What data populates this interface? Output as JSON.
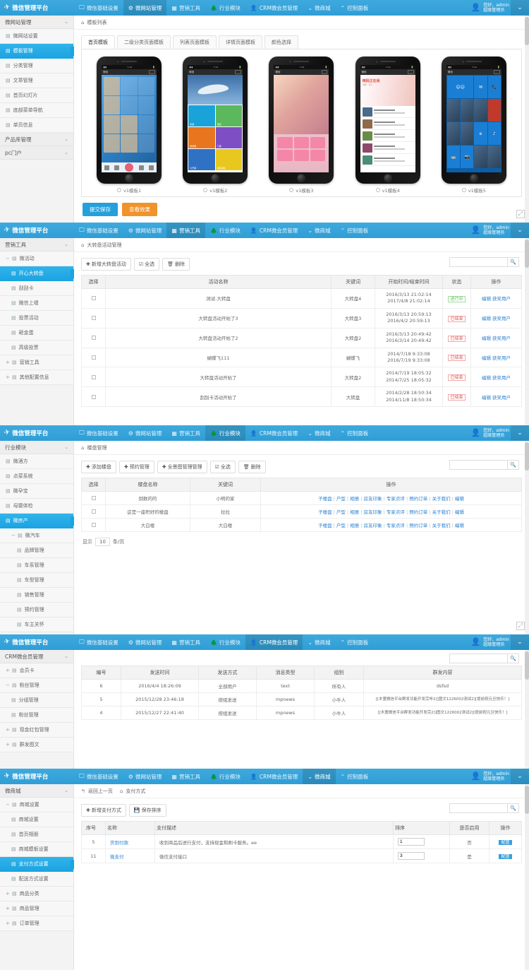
{
  "brand": {
    "name": "微信管理平台",
    "logo_icon": "paper-plane-icon"
  },
  "topnav": [
    {
      "label": "微信基础设置",
      "icon": "monitor-icon",
      "active": false
    },
    {
      "label": "微网站管理",
      "icon": "gear-icon",
      "active": true
    },
    {
      "label": "营销工具",
      "icon": "grid-icon",
      "active": false
    },
    {
      "label": "行业模块",
      "icon": "tree-icon",
      "active": false
    },
    {
      "label": "CRM微会员管理",
      "icon": "user-icon",
      "active": false
    },
    {
      "label": "微商城",
      "icon": "chevron-down-icon",
      "active": false
    },
    {
      "label": "控制面板",
      "icon": "chevron-up-icon",
      "active": false
    }
  ],
  "user": {
    "greeting": "您好，admin",
    "role": "超级管理员",
    "avatar_icon": "user-avatar-icon",
    "caret_icon": "chevron-down-icon"
  },
  "search": {
    "placeholder": "",
    "value": "",
    "icon": "search-icon"
  },
  "panel1": {
    "nav_active": "微网站管理",
    "breadcrumb": "模板列表",
    "sidebar_title": "微网站管理",
    "sidebar": [
      {
        "label": "微网站设置",
        "level": 1,
        "active": false,
        "pm": ""
      },
      {
        "label": "模板管理",
        "level": 1,
        "active": true,
        "pm": ""
      },
      {
        "label": "分类管理",
        "level": 1,
        "active": false,
        "pm": ""
      },
      {
        "label": "文章管理",
        "level": 1,
        "active": false,
        "pm": ""
      },
      {
        "label": "首页幻灯片",
        "level": 1,
        "active": false,
        "pm": ""
      },
      {
        "label": "底部菜单导航",
        "level": 1,
        "active": false,
        "pm": ""
      },
      {
        "label": "单页信息",
        "level": 1,
        "active": false,
        "pm": ""
      }
    ],
    "sidebar_groups": [
      {
        "label": "产品库管理",
        "chev": "⌄"
      },
      {
        "label": "pc门户",
        "chev": "⌄"
      }
    ],
    "tabs": [
      {
        "label": "首页模板",
        "active": true
      },
      {
        "label": "二级分类页面模板",
        "active": false
      },
      {
        "label": "列表页面模板",
        "active": false
      },
      {
        "label": "详情页面模板",
        "active": false
      },
      {
        "label": "颜色选择",
        "active": false
      }
    ],
    "templates": [
      {
        "label": "v1模板1",
        "selected": false
      },
      {
        "label": "v1模板2",
        "selected": false
      },
      {
        "label": "v1模板3",
        "selected": false
      },
      {
        "label": "v1模板4",
        "selected": false
      },
      {
        "label": "v1模板5",
        "selected": false
      }
    ],
    "phone2_tiles": [
      "机票",
      "酒店",
      "旅游团",
      "门票",
      "大巴票",
      "游轮邮轮"
    ],
    "buttons": [
      {
        "label": "提交保存",
        "color": "#26a0da"
      },
      {
        "label": "查看效果",
        "color": "#f0932b"
      }
    ]
  },
  "panel2": {
    "nav_active": "营销工具",
    "breadcrumb": "大转盘活动管理",
    "sidebar_title": "营销工具",
    "sidebar": [
      {
        "label": "微活动",
        "level": 1,
        "active": false,
        "pm": "−"
      },
      {
        "label": "开心大转盘",
        "level": 2,
        "active": true,
        "pm": ""
      },
      {
        "label": "刮刮卡",
        "level": 2,
        "active": false,
        "pm": ""
      },
      {
        "label": "微信上墙",
        "level": 2,
        "active": false,
        "pm": ""
      },
      {
        "label": "投票活动",
        "level": 2,
        "active": false,
        "pm": ""
      },
      {
        "label": "砸金蛋",
        "level": 2,
        "active": false,
        "pm": ""
      },
      {
        "label": "高级投票",
        "level": 2,
        "active": false,
        "pm": ""
      },
      {
        "label": "营销工具",
        "level": 1,
        "active": false,
        "pm": "+"
      },
      {
        "label": "其他配置信息",
        "level": 1,
        "active": false,
        "pm": "+"
      }
    ],
    "toolbar": [
      {
        "label": "新增大转盘活动",
        "icon": "plus-icon"
      },
      {
        "label": "全选",
        "icon": "checkbox-icon"
      },
      {
        "label": "删除",
        "icon": "trash-icon"
      }
    ],
    "columns": [
      "选择",
      "活动名称",
      "关键词",
      "开始时间/结束时间",
      "状态",
      "操作"
    ],
    "rows": [
      {
        "name": "测试-大转盘",
        "keyword": "大转盘4",
        "start": "2016/3/13 21:02:14",
        "end": "2017/4/8 21:02:14",
        "status": "进行中",
        "status_type": "running",
        "ops": [
          "编辑",
          "获奖用户"
        ]
      },
      {
        "name": "大转盘活动开始了3",
        "keyword": "大转盘3",
        "start": "2016/3/13 20:59:13",
        "end": "2016/4/2 20:59:13",
        "status": "已结束",
        "status_type": "ended",
        "ops": [
          "编辑",
          "获奖用户"
        ]
      },
      {
        "name": "大转盘活动开始了2",
        "keyword": "大转盘2",
        "start": "2016/3/13 20:49:42",
        "end": "2016/3/14 20:49:42",
        "status": "已结束",
        "status_type": "ended",
        "ops": [
          "编辑",
          "获奖用户"
        ]
      },
      {
        "name": "蝴蝶飞111",
        "keyword": "蝴蝶飞",
        "start": "2014/7/18 9:33:08",
        "end": "2016/7/19 9:33:08",
        "status": "已结束",
        "status_type": "ended",
        "ops": [
          "编辑",
          "获奖用户"
        ]
      },
      {
        "name": "大转盘活动开始了",
        "keyword": "大转盘2",
        "start": "2014/7/19 18:05:32",
        "end": "2014/7/25 18:05:32",
        "status": "已结束",
        "status_type": "ended",
        "ops": [
          "编辑",
          "获奖用户"
        ]
      },
      {
        "name": "刮刮卡活动开始了",
        "keyword": "大转盘",
        "start": "2014/2/28 18:50:34",
        "end": "2014/11/8 18:50:34",
        "status": "已结束",
        "status_type": "ended",
        "ops": [
          "编辑",
          "获奖用户"
        ]
      }
    ]
  },
  "panel3": {
    "nav_active": "行业模块",
    "breadcrumb": "楼盘管理",
    "sidebar_title": "行业模块",
    "sidebar": [
      {
        "label": "微酒方",
        "level": 1,
        "active": false,
        "pm": ""
      },
      {
        "label": "点菜系统",
        "level": 1,
        "active": false,
        "pm": ""
      },
      {
        "label": "微孕宝",
        "level": 1,
        "active": false,
        "pm": ""
      },
      {
        "label": "母婴体检",
        "level": 1,
        "active": false,
        "pm": ""
      },
      {
        "label": "微房产",
        "level": 1,
        "active": true,
        "pm": ""
      },
      {
        "label": "微汽车",
        "level": 1,
        "active": false,
        "pm": "−"
      },
      {
        "label": "品牌管理",
        "level": 3,
        "active": false,
        "pm": ""
      },
      {
        "label": "车系管理",
        "level": 3,
        "active": false,
        "pm": ""
      },
      {
        "label": "车型管理",
        "level": 3,
        "active": false,
        "pm": ""
      },
      {
        "label": "销售管理",
        "level": 3,
        "active": false,
        "pm": ""
      },
      {
        "label": "预约管理",
        "level": 3,
        "active": false,
        "pm": ""
      },
      {
        "label": "车主关怀",
        "level": 3,
        "active": false,
        "pm": ""
      }
    ],
    "toolbar": [
      {
        "label": "添加楼盘",
        "icon": "plus-icon"
      },
      {
        "label": "预约管理",
        "icon": "plus-icon"
      },
      {
        "label": "全景图管理管理",
        "icon": "plus-icon"
      },
      {
        "label": "全选",
        "icon": "checkbox-icon"
      },
      {
        "label": "删除",
        "icon": "trash-icon"
      }
    ],
    "columns": [
      "选择",
      "楼盘名称",
      "关键词",
      "操作"
    ],
    "ops": [
      "子楼盘",
      "户型",
      "相册",
      "房友印象",
      "专家点评",
      "预约订单",
      "关于我们",
      "编辑"
    ],
    "rows": [
      {
        "name": "倒数的的",
        "keyword": "小明的家"
      },
      {
        "name": "这是一座积好的楼盘",
        "keyword": "拉拉"
      },
      {
        "name": "大白楼",
        "keyword": "大白楼"
      }
    ],
    "pager": {
      "prefix": "显示",
      "size": "10",
      "suffix": "条/页"
    }
  },
  "panel4": {
    "nav_active": "CRM微会员管理",
    "breadcrumb": "",
    "sidebar_title": "CRM微会员管理",
    "sidebar": [
      {
        "label": "会员卡",
        "level": 1,
        "active": false,
        "pm": "+"
      },
      {
        "label": "粉丝管理",
        "level": 1,
        "active": false,
        "pm": "−"
      },
      {
        "label": "分组管理",
        "level": 2,
        "active": false,
        "pm": ""
      },
      {
        "label": "粉丝管理",
        "level": 2,
        "active": false,
        "pm": ""
      },
      {
        "label": "现金红包管理",
        "level": 1,
        "active": false,
        "pm": "+"
      },
      {
        "label": "群发图文",
        "level": 1,
        "active": false,
        "pm": "+"
      }
    ],
    "columns": [
      "编号",
      "发送时间",
      "发送方式",
      "消息类型",
      "组别",
      "群发内容"
    ],
    "rows": [
      {
        "id": "6",
        "time": "2016/4/4 18:26:09",
        "method": "全部用户",
        "type": "text",
        "group": "所有人",
        "content": "dsfsd"
      },
      {
        "id": "5",
        "time": "2015/12/28 23:46:18",
        "method": "按组发送",
        "type": "mpnews",
        "group": "小牛人",
        "content": "[[木童微信平台群发功能开发完毕2]]图文1226002测试2][提前祝元旦快乐！]"
      },
      {
        "id": "4",
        "time": "2015/12/27 22:41:40",
        "method": "按组发送",
        "type": "mpnews",
        "group": "小牛人",
        "content": "[[木童微信平台群发功能开发完2]]图文1226002测试2][提前祝元旦快乐！]"
      }
    ]
  },
  "panel5": {
    "nav_active": "微商城",
    "breadcrumb_back": "返回上一页",
    "breadcrumb": "支付方式",
    "sidebar_title": "微商城",
    "sidebar": [
      {
        "label": "商城设置",
        "level": 1,
        "active": false,
        "pm": "−"
      },
      {
        "label": "商城设置",
        "level": 2,
        "active": false,
        "pm": ""
      },
      {
        "label": "首页相册",
        "level": 2,
        "active": false,
        "pm": ""
      },
      {
        "label": "商城模板设置",
        "level": 2,
        "active": false,
        "pm": ""
      },
      {
        "label": "支付方式设置",
        "level": 2,
        "active": true,
        "pm": ""
      },
      {
        "label": "配送方式设置",
        "level": 2,
        "active": false,
        "pm": ""
      },
      {
        "label": "商品分类",
        "level": 1,
        "active": false,
        "pm": "+"
      },
      {
        "label": "商品管理",
        "level": 1,
        "active": false,
        "pm": "+"
      },
      {
        "label": "订单管理",
        "level": 1,
        "active": false,
        "pm": "+"
      }
    ],
    "toolbar": [
      {
        "label": "新增支付方式",
        "icon": "plus-icon"
      },
      {
        "label": "保存排序",
        "icon": "save-icon"
      }
    ],
    "columns": [
      "序号",
      "名称",
      "支付描述",
      "排序",
      "是否启用",
      "操作"
    ],
    "rows": [
      {
        "id": "5",
        "name": "货到付款",
        "desc": "收到商品后进行支付，支持现金和刷卡服务。ee",
        "order": "1",
        "enabled": "否",
        "op": "配置"
      },
      {
        "id": "11",
        "name": "微支付",
        "desc": "微信支付接口",
        "order": "3",
        "enabled": "是",
        "op": "配置"
      }
    ]
  }
}
